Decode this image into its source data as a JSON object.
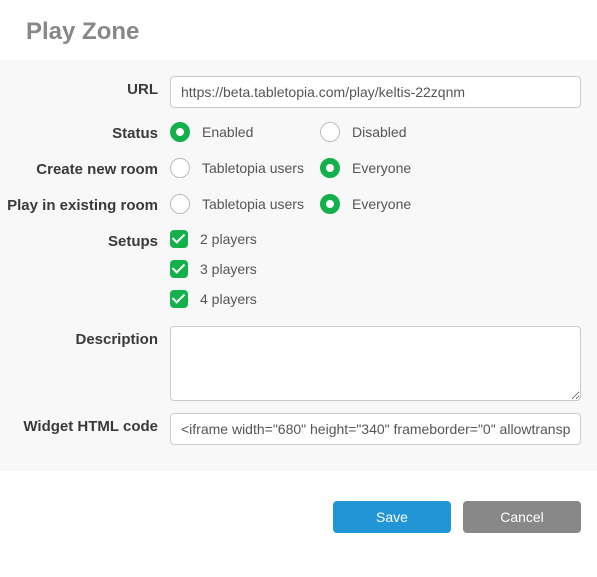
{
  "header": {
    "title": "Play Zone"
  },
  "labels": {
    "url": "URL",
    "status": "Status",
    "create_room": "Create new room",
    "existing_room": "Play in existing room",
    "setups": "Setups",
    "description": "Description",
    "widget": "Widget HTML code"
  },
  "url": {
    "value": "https://beta.tabletopia.com/play/keltis-22zqnm"
  },
  "status": {
    "options": [
      {
        "label": "Enabled",
        "checked": true
      },
      {
        "label": "Disabled",
        "checked": false
      }
    ]
  },
  "create_room": {
    "options": [
      {
        "label": "Tabletopia users",
        "checked": false
      },
      {
        "label": "Everyone",
        "checked": true
      }
    ]
  },
  "existing_room": {
    "options": [
      {
        "label": "Tabletopia users",
        "checked": false
      },
      {
        "label": "Everyone",
        "checked": true
      }
    ]
  },
  "setups": {
    "options": [
      {
        "label": "2 players",
        "checked": true
      },
      {
        "label": "3 players",
        "checked": true
      },
      {
        "label": "4 players",
        "checked": true
      }
    ]
  },
  "description": {
    "value": ""
  },
  "widget": {
    "value": "<iframe width=\"680\" height=\"340\" frameborder=\"0\" allowtranspa"
  },
  "buttons": {
    "save": "Save",
    "cancel": "Cancel"
  }
}
